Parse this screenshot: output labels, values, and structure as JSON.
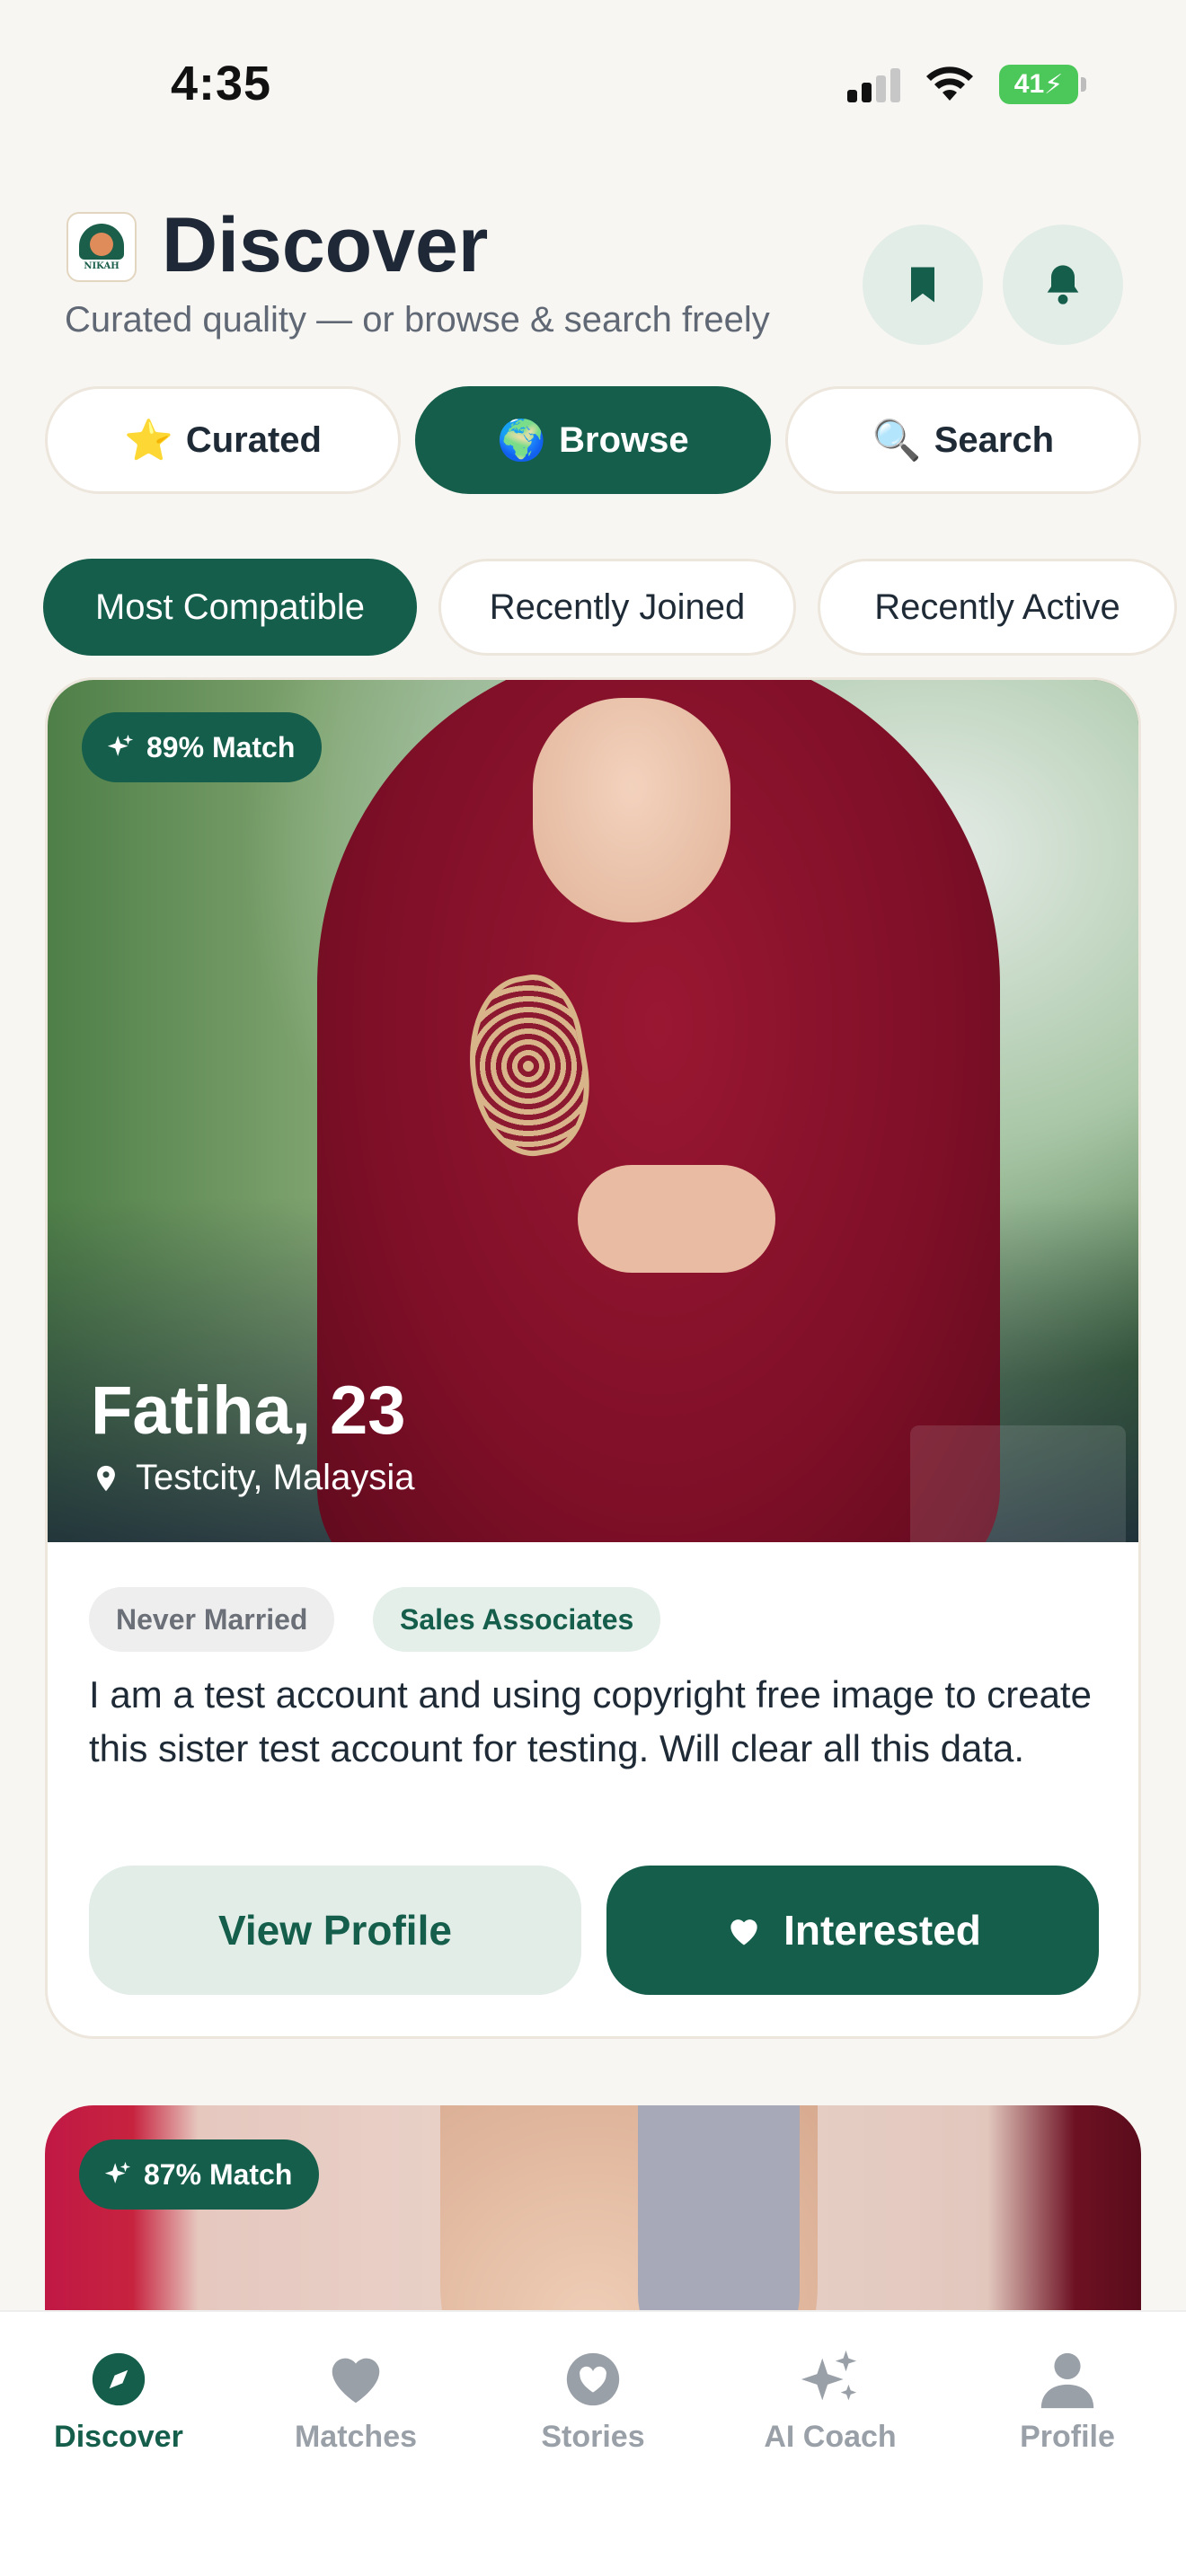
{
  "status_bar": {
    "time": "4:35",
    "battery": "41"
  },
  "header": {
    "logo_text": "NIKAH",
    "title": "Discover",
    "subtitle": "Curated quality — or browse & search freely"
  },
  "mode_tabs": [
    {
      "emoji": "⭐",
      "label": "Curated",
      "active": false
    },
    {
      "emoji": "🌍",
      "label": "Browse",
      "active": true
    },
    {
      "emoji": "🔍",
      "label": "Search",
      "active": false
    }
  ],
  "sort_chips": [
    {
      "label": "Most Compatible",
      "active": true
    },
    {
      "label": "Recently Joined",
      "active": false
    },
    {
      "label": "Recently Active",
      "active": false
    }
  ],
  "profiles": [
    {
      "match": "89% Match",
      "name_age": "Fatiha, 23",
      "location": "Testcity, Malaysia",
      "tags": [
        "Never Married",
        "Sales Associates"
      ],
      "bio": "I am a test account and using copyright free image to create this sister test account for testing. Will clear all this data.",
      "view_label": "View Profile",
      "interest_label": "Interested"
    },
    {
      "match": "87% Match"
    }
  ],
  "bottom_nav": [
    {
      "label": "Discover",
      "icon": "compass-icon",
      "active": true
    },
    {
      "label": "Matches",
      "icon": "heart-icon",
      "active": false
    },
    {
      "label": "Stories",
      "icon": "heart-circle-icon",
      "active": false
    },
    {
      "label": "AI Coach",
      "icon": "sparkles-icon",
      "active": false
    },
    {
      "label": "Profile",
      "icon": "person-icon",
      "active": false
    }
  ],
  "colors": {
    "primary": "#155e4b",
    "background": "#f8f6f2",
    "primary_light": "#e2ede8"
  }
}
